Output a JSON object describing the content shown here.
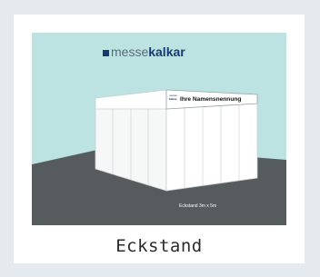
{
  "logo": {
    "part1": "messe",
    "part2": "kalkar",
    "colors": {
      "part1": "#5a6b78",
      "part2": "#163a72"
    }
  },
  "fascia": {
    "brand_top": "messe",
    "brand_bottom": "kalkar",
    "name": "Ihre Namensnennung"
  },
  "floor_label": "Eckstand 3m x 5m",
  "caption": "Eckstand",
  "colors": {
    "sky": "#bce2e2",
    "floor": "#565b5e",
    "card": "#ffffff",
    "page": "#e4eaee"
  }
}
